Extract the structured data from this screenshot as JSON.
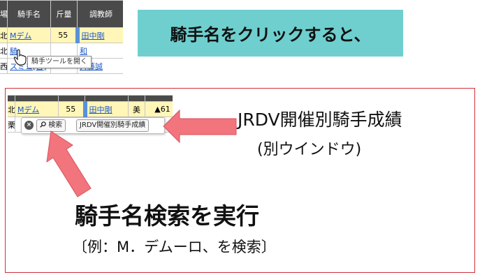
{
  "banner": {
    "text": "騎手名をクリックすると、"
  },
  "top_table": {
    "headers": [
      "場/所属",
      "騎手名",
      "斤量",
      "調教師"
    ],
    "rows": [
      {
        "cells": [
          "北",
          "Mデム",
          "55",
          "田中剛"
        ],
        "highlight": true
      },
      {
        "cells": [
          "北",
          "騎",
          "",
          "和"
        ],
        "highlight": false
      },
      {
        "cells": [
          "西",
          "スミヨ[替]",
          "",
          "斉藤誠"
        ],
        "highlight": false
      }
    ]
  },
  "tooltip": {
    "text": "騎手ツールを開く"
  },
  "inner_table": {
    "row1": [
      "北",
      "Mデム",
      "55",
      "田中剛",
      "美",
      "▲61"
    ],
    "row2": [
      "栗",
      "",
      "",
      "",
      "",
      ""
    ]
  },
  "toolbar": {
    "close_icon": "×",
    "search_icon": "search-icon",
    "search_label": "検索",
    "jrdv_label": "JRDV開催別騎手成績"
  },
  "annotations": {
    "jrdv_title": "JRDV開催別騎手成績",
    "jrdv_sub": "(別ウインドウ)",
    "search_title": "騎手名検索を実行",
    "search_example": "〔例：M．デムーロ、を検索〕"
  },
  "colors": {
    "banner_bg": "#6fcfcf",
    "frame": "#d0303a",
    "arrow": "#f2747c",
    "row_highlight": "#fff6b8",
    "link": "#1a56c4"
  }
}
